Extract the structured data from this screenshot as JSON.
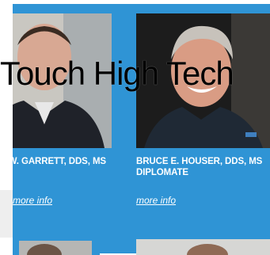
{
  "overlay_text": "Touch High Tech",
  "colors": {
    "panel": "#2f94d5",
    "text": "#ffffff"
  },
  "doctors": [
    {
      "name": "W. GARRETT, DDS, MS",
      "link": "more info",
      "photo_icon": "doctor-portrait-icon"
    },
    {
      "name": "BRUCE E. HOUSER, DDS, MS DIPLOMATE",
      "link": "more info",
      "photo_icon": "doctor-portrait-icon"
    }
  ]
}
